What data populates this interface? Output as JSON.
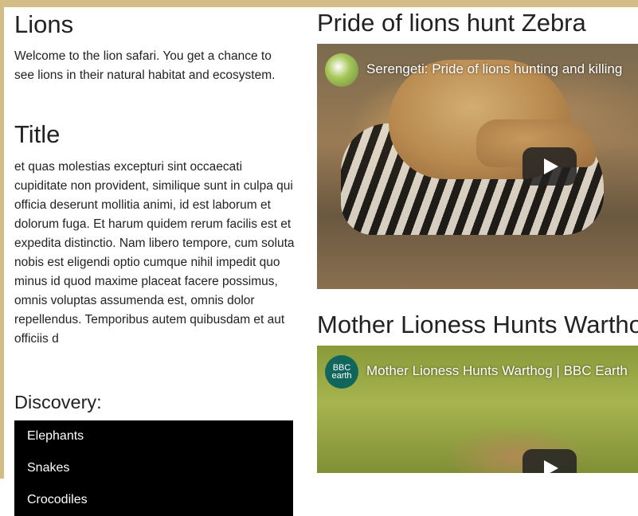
{
  "left": {
    "title": "Lions",
    "intro": "Welcome to the lion safari. You get a chance to see lions in their natural habitat and ecosystem.",
    "section_title": "Title",
    "section_body": "et quas molestias excepturi sint occaecati cupiditate non provident, similique sunt in culpa qui officia deserunt mollitia animi, id est laborum et dolorum fuga. Et harum quidem rerum facilis est et expedita distinctio. Nam libero tempore, cum soluta nobis est eligendi optio cumque nihil impedit quo minus id quod maxime placeat facere possimus, omnis voluptas assumenda est, omnis dolor repellendus. Temporibus autem quibusdam et aut officiis d",
    "discovery_heading": "Discovery:",
    "nav": [
      {
        "label": "Elephants"
      },
      {
        "label": "Snakes"
      },
      {
        "label": "Crocodiles"
      }
    ]
  },
  "right": {
    "videos": [
      {
        "heading": "Pride of lions hunt Zebra",
        "title": "Serengeti: Pride of lions hunting and killing",
        "channel_logo_text": ""
      },
      {
        "heading": "Mother Lioness Hunts Warthog",
        "title": "Mother Lioness Hunts Warthog | BBC Earth",
        "channel_logo_text": "BBC earth"
      }
    ]
  },
  "colors": {
    "accent": "#d1bd85",
    "nav_bg": "#000000",
    "bbc_logo": "#11665c"
  }
}
